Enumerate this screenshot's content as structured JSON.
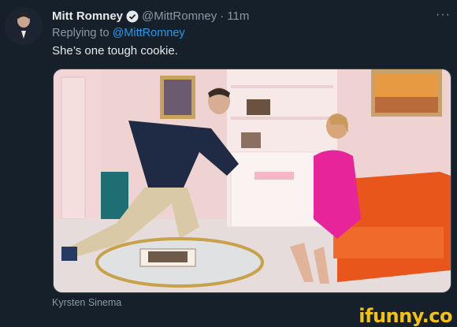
{
  "tweet": {
    "author_name": "Mitt Romney",
    "handle": "@MittRomney",
    "separator": "·",
    "time": "11m",
    "more_label": "···",
    "replying_prefix": "Replying to",
    "replying_handle": "@MittRomney",
    "text": "She’s one tough cookie.",
    "media_caption": "Kyrsten Sinema"
  },
  "watermark": "ifunny.co",
  "colors": {
    "background": "#15202b",
    "link": "#1d9bf0",
    "secondary_text": "#8b98a5",
    "watermark": "#f4c20d"
  }
}
